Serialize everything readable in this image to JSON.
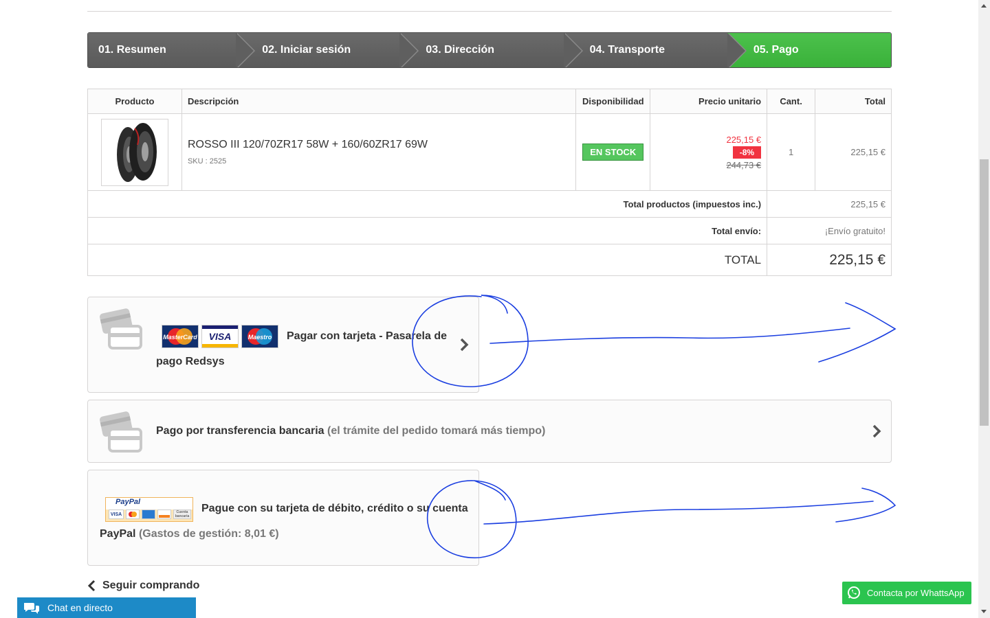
{
  "steps": [
    {
      "label": "01. Resumen"
    },
    {
      "label": "02. Iniciar sesión"
    },
    {
      "label": "03. Dirección"
    },
    {
      "label": "04. Transporte"
    },
    {
      "label": "05. Pago"
    }
  ],
  "cart": {
    "headers": {
      "product": "Producto",
      "description": "Descripción",
      "availability": "Disponibilidad",
      "unit_price": "Precio unitario",
      "qty": "Cant.",
      "total": "Total"
    },
    "item": {
      "name": "ROSSO III 120/70ZR17 58W + 160/60ZR17 69W",
      "sku": "SKU : 2525",
      "availability": "EN STOCK",
      "price": "225,15 €",
      "discount": "-8%",
      "old_price": "244,73 €",
      "qty": "1",
      "total": "225,15 €"
    },
    "summary": {
      "products_label": "Total productos (impuestos inc.)",
      "products_value": "225,15 €",
      "shipping_label": "Total envío:",
      "shipping_value": "¡Envío gratuito!",
      "total_label": "TOTAL",
      "total_value": "225,15 €"
    }
  },
  "payments": {
    "card": {
      "text": "Pagar con tarjeta - Pasarela de",
      "text2": "pago Redsys",
      "logos": [
        "MasterCard",
        "VISA",
        "Maestro"
      ]
    },
    "transfer": {
      "text": "Pago por transferencia bancaria",
      "note": "(el trámite del pedido tomará más tiempo)"
    },
    "paypal": {
      "logo": "PayPal",
      "logo_badges": [
        "VISA",
        "Cuenta bancaria"
      ],
      "text": "Pague con su tarjeta de débito, crédito o su cuenta",
      "text2": "PayPal",
      "note": "(Gastos de gestión: 8,01 €)"
    }
  },
  "continue_label": "Seguir comprando",
  "chat_label": "Chat en directo",
  "whatsapp_label": "Contacta por WhattsApp",
  "colors": {
    "step_bg": "#5f5f5f",
    "step_current": "#46bd46",
    "stock": "#55c65e",
    "discount": "#f13340",
    "chat": "#1d8ac7",
    "whatsapp": "#2bc44f",
    "annotation": "#1a3ee0"
  }
}
